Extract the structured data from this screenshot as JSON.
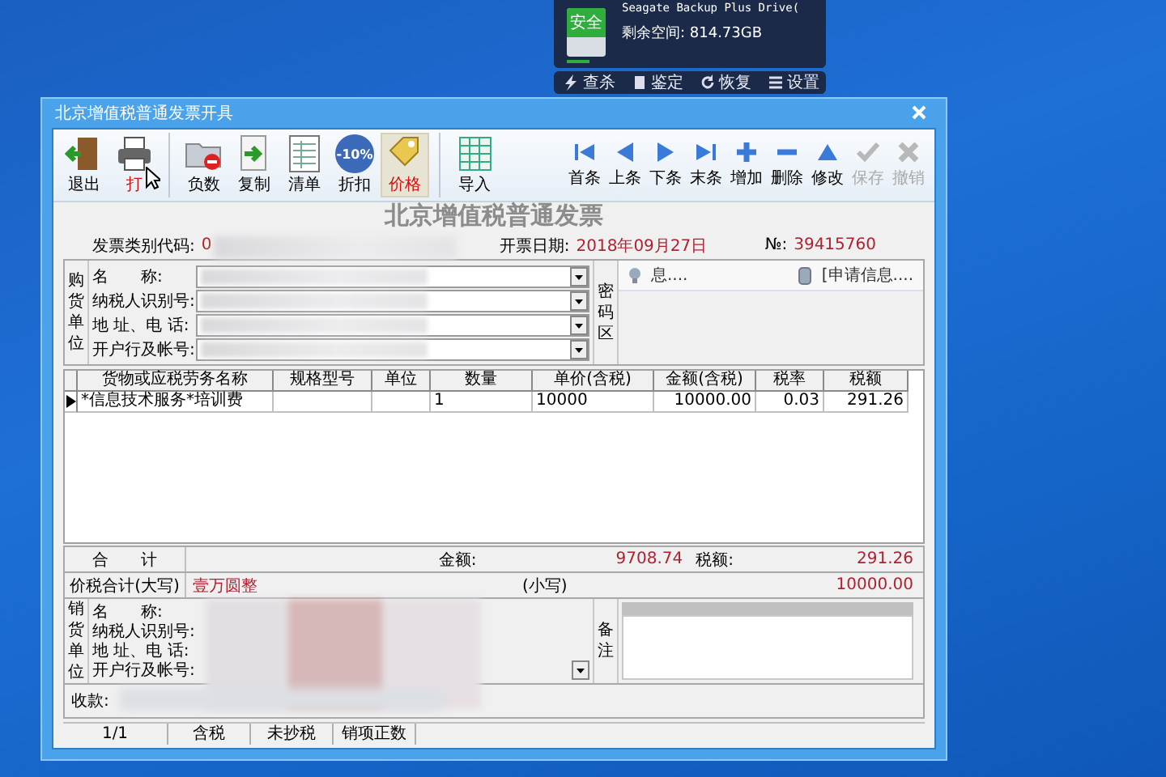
{
  "drive_widget": {
    "badge": "安全",
    "drive_name": "Seagate Backup Plus Drive(",
    "free_space": "剩余空间: 814.73GB",
    "actions": [
      {
        "kind": "scan",
        "label": "查杀"
      },
      {
        "kind": "check",
        "label": "鉴定"
      },
      {
        "kind": "restore",
        "label": "恢复"
      },
      {
        "kind": "settings",
        "label": "设置"
      }
    ]
  },
  "window": {
    "title": "北京增值税普通发票开具"
  },
  "toolbar": {
    "groups": [
      {
        "items": [
          {
            "kind": "exit",
            "label": "退出",
            "highlighted": false,
            "disabled": false
          },
          {
            "kind": "print",
            "label": "打",
            "highlighted": true,
            "disabled": false
          }
        ]
      },
      {
        "items": [
          {
            "kind": "negative",
            "label": "负数",
            "highlighted": false,
            "disabled": false
          },
          {
            "kind": "copy",
            "label": "复制",
            "highlighted": false,
            "disabled": false
          },
          {
            "kind": "list",
            "label": "清单",
            "highlighted": false,
            "disabled": false
          },
          {
            "kind": "discount",
            "label": "折扣",
            "badge": "-10%",
            "highlighted": false,
            "disabled": false
          },
          {
            "kind": "price",
            "label": "价格",
            "highlighted": true,
            "disabled": false
          }
        ]
      },
      {
        "items": [
          {
            "kind": "import",
            "label": "导入",
            "highlighted": false,
            "disabled": false
          }
        ]
      }
    ],
    "nav": [
      {
        "kind": "first",
        "label": "首条",
        "disabled": false
      },
      {
        "kind": "prev",
        "label": "上条",
        "disabled": false
      },
      {
        "kind": "next",
        "label": "下条",
        "disabled": false
      },
      {
        "kind": "last",
        "label": "末条",
        "disabled": false
      },
      {
        "kind": "add",
        "label": "增加",
        "disabled": false
      },
      {
        "kind": "delete",
        "label": "删除",
        "disabled": false
      },
      {
        "kind": "edit",
        "label": "修改",
        "disabled": false
      },
      {
        "kind": "save",
        "label": "保存",
        "disabled": true
      },
      {
        "kind": "undo",
        "label": "撤销",
        "disabled": true
      }
    ]
  },
  "invoice": {
    "title": "北京增值税普通发票",
    "code_label": "发票类别代码:",
    "code_value": "0",
    "date_label": "开票日期:",
    "date": "2018年09月27日",
    "number_label": "№:",
    "number": "39415760",
    "buyer": {
      "section": "购货单位",
      "fields": [
        {
          "label": "名　　称:"
        },
        {
          "label": "纳税人识别号:"
        },
        {
          "label": "地 址、电 话:"
        },
        {
          "label": "开户行及帐号:"
        }
      ]
    },
    "cipher": {
      "section": "密码区",
      "items": [
        {
          "kind": "bulb",
          "text": "息...."
        },
        {
          "kind": "card",
          "text": "[申请信息...."
        }
      ]
    },
    "table": {
      "columns": [
        "货物或应税劳务名称",
        "规格型号",
        "单位",
        "数量",
        "单价(含税)",
        "金额(含税)",
        "税率",
        "税额"
      ],
      "rows": [
        {
          "selected": true,
          "cells": [
            "*信息技术服务*培训费",
            "",
            "",
            "1",
            "10000",
            "10000.00",
            "0.03",
            "291.26"
          ]
        }
      ]
    },
    "totals": {
      "label": "合　　计",
      "amount_label": "金额:",
      "amount": "9708.74",
      "tax_label": "税额:",
      "tax": "291.26"
    },
    "grand_total": {
      "label": "价税合计(大写)",
      "words": "壹万圆整",
      "small_label": "(小写)",
      "figure": "10000.00"
    },
    "seller": {
      "section": "销货单位",
      "fields": [
        {
          "label": "名　　称:"
        },
        {
          "label": "纳税人识别号:"
        },
        {
          "label": "地 址、电 话:"
        },
        {
          "label": "开户行及帐号:"
        }
      ]
    },
    "remark": {
      "section": "备注"
    },
    "payee_label": "收款:"
  },
  "status_bar": [
    "1/1",
    "含税",
    "未抄税",
    "销项正数"
  ]
}
